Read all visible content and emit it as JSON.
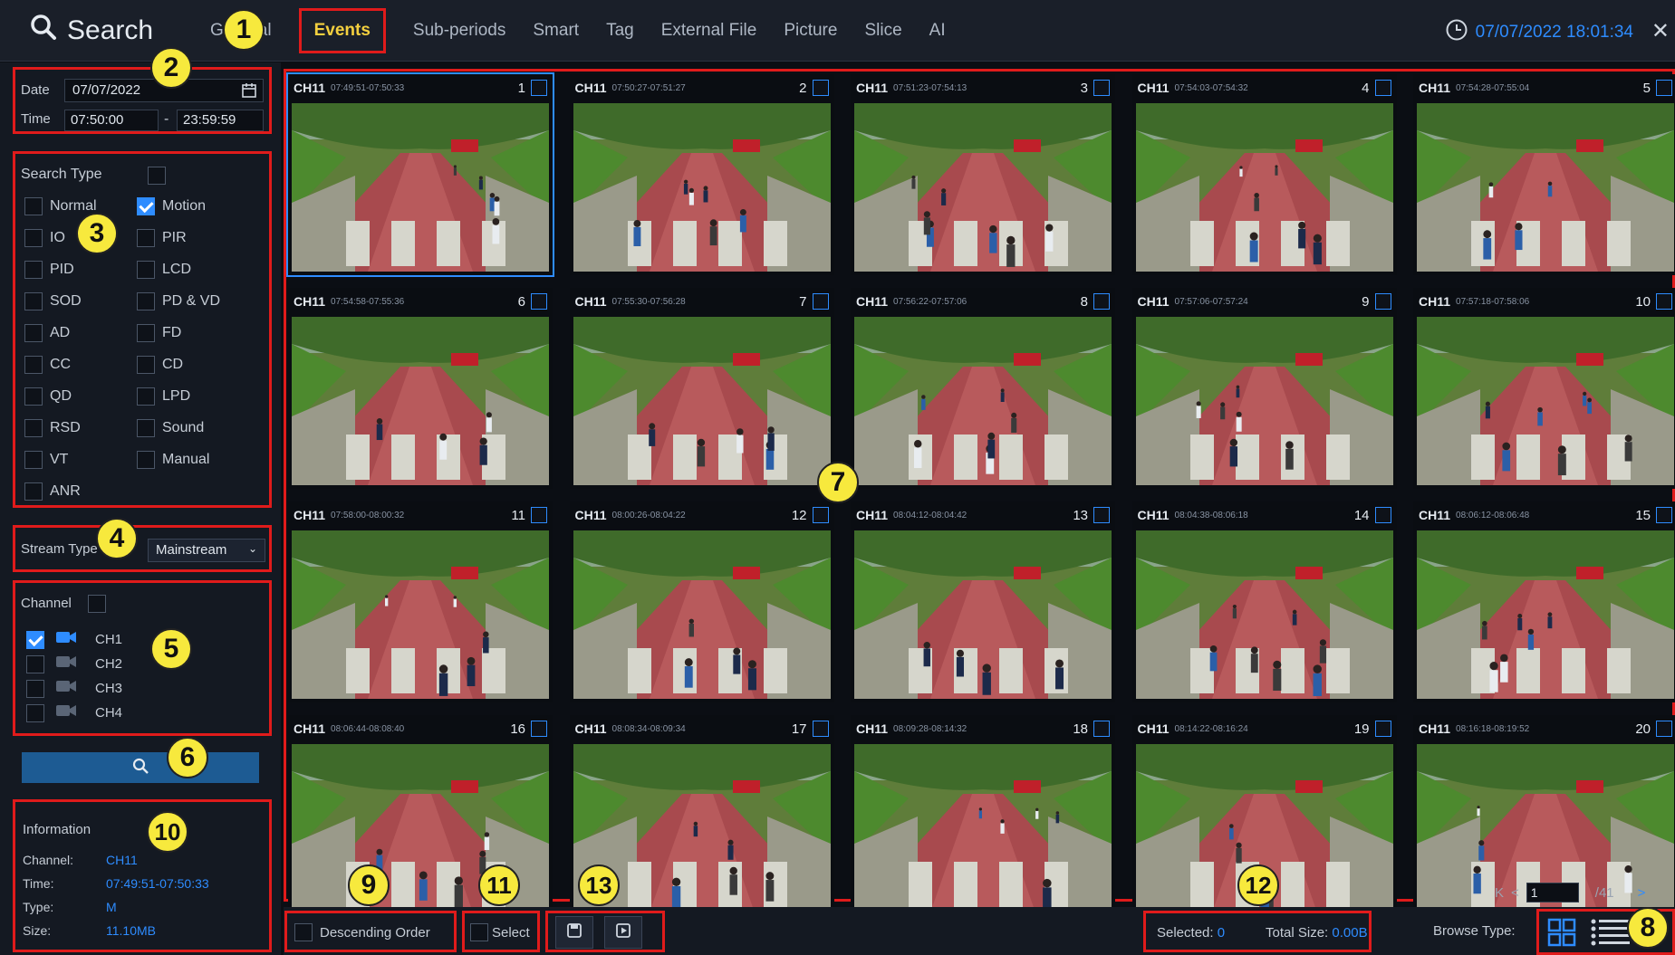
{
  "header": {
    "title": "Search",
    "clock": "07/07/2022 18:01:34",
    "close": "✕"
  },
  "tabs": [
    "General",
    "Events",
    "Sub-periods",
    "Smart",
    "Tag",
    "External File",
    "Picture",
    "Slice",
    "AI"
  ],
  "active_tab": "Events",
  "datetime": {
    "date_label": "Date",
    "date": "07/07/2022",
    "time_label": "Time",
    "time_start": "07:50:00",
    "time_sep": "-",
    "time_end": "23:59:59"
  },
  "search_type": {
    "label": "Search Type",
    "options": [
      {
        "label": "Normal",
        "checked": false
      },
      {
        "label": "Motion",
        "checked": true
      },
      {
        "label": "IO",
        "checked": false
      },
      {
        "label": "PIR",
        "checked": false
      },
      {
        "label": "PID",
        "checked": false
      },
      {
        "label": "LCD",
        "checked": false
      },
      {
        "label": "SOD",
        "checked": false
      },
      {
        "label": "PD & VD",
        "checked": false
      },
      {
        "label": "AD",
        "checked": false
      },
      {
        "label": "FD",
        "checked": false
      },
      {
        "label": "CC",
        "checked": false
      },
      {
        "label": "CD",
        "checked": false
      },
      {
        "label": "QD",
        "checked": false
      },
      {
        "label": "LPD",
        "checked": false
      },
      {
        "label": "RSD",
        "checked": false
      },
      {
        "label": "Sound",
        "checked": false
      },
      {
        "label": "VT",
        "checked": false
      },
      {
        "label": "Manual",
        "checked": false
      },
      {
        "label": "ANR",
        "checked": false
      }
    ]
  },
  "stream": {
    "label": "Stream Type",
    "value": "Mainstream"
  },
  "channel": {
    "label": "Channel",
    "items": [
      {
        "label": "CH1",
        "checked": true
      },
      {
        "label": "CH2",
        "checked": false
      },
      {
        "label": "CH3",
        "checked": false
      },
      {
        "label": "CH4",
        "checked": false
      }
    ]
  },
  "information": {
    "title": "Information",
    "channel_label": "Channel:",
    "channel": "CH11",
    "time_label": "Time:",
    "time": "07:49:51-07:50:33",
    "type_label": "Type:",
    "type": "M",
    "size_label": "Size:",
    "size": "11.10MB"
  },
  "events": [
    {
      "ch": "CH11",
      "time": "07:49:51-07:50:33",
      "num": "1",
      "selected": true
    },
    {
      "ch": "CH11",
      "time": "07:50:27-07:51:27",
      "num": "2"
    },
    {
      "ch": "CH11",
      "time": "07:51:23-07:54:13",
      "num": "3"
    },
    {
      "ch": "CH11",
      "time": "07:54:03-07:54:32",
      "num": "4"
    },
    {
      "ch": "CH11",
      "time": "07:54:28-07:55:04",
      "num": "5"
    },
    {
      "ch": "CH11",
      "time": "07:54:58-07:55:36",
      "num": "6"
    },
    {
      "ch": "CH11",
      "time": "07:55:30-07:56:28",
      "num": "7"
    },
    {
      "ch": "CH11",
      "time": "07:56:22-07:57:06",
      "num": "8"
    },
    {
      "ch": "CH11",
      "time": "07:57:06-07:57:24",
      "num": "9"
    },
    {
      "ch": "CH11",
      "time": "07:57:18-07:58:06",
      "num": "10"
    },
    {
      "ch": "CH11",
      "time": "07:58:00-08:00:32",
      "num": "11"
    },
    {
      "ch": "CH11",
      "time": "08:00:26-08:04:22",
      "num": "12"
    },
    {
      "ch": "CH11",
      "time": "08:04:12-08:04:42",
      "num": "13"
    },
    {
      "ch": "CH11",
      "time": "08:04:38-08:06:18",
      "num": "14"
    },
    {
      "ch": "CH11",
      "time": "08:06:12-08:06:48",
      "num": "15"
    },
    {
      "ch": "CH11",
      "time": "08:06:44-08:08:40",
      "num": "16"
    },
    {
      "ch": "CH11",
      "time": "08:08:34-08:09:34",
      "num": "17"
    },
    {
      "ch": "CH11",
      "time": "08:09:28-08:14:32",
      "num": "18"
    },
    {
      "ch": "CH11",
      "time": "08:14:22-08:16:24",
      "num": "19"
    },
    {
      "ch": "CH11",
      "time": "08:16:18-08:19:52",
      "num": "20"
    }
  ],
  "pager": {
    "current": "1",
    "total": "/41"
  },
  "bottom": {
    "descending": "Descending Order",
    "select": "Select",
    "selected_label": "Selected:",
    "selected": "0",
    "total_label": "Total Size:",
    "total": "0.00B",
    "browse_label": "Browse Type:"
  },
  "callouts": [
    "1",
    "2",
    "3",
    "4",
    "5",
    "6",
    "7",
    "8",
    "9",
    "10",
    "11",
    "12",
    "13"
  ],
  "colors": {
    "accent": "#2e8cff",
    "highlight": "#e01b1b",
    "active_tab": "#f4d03f",
    "callout": "#f7e93d"
  }
}
